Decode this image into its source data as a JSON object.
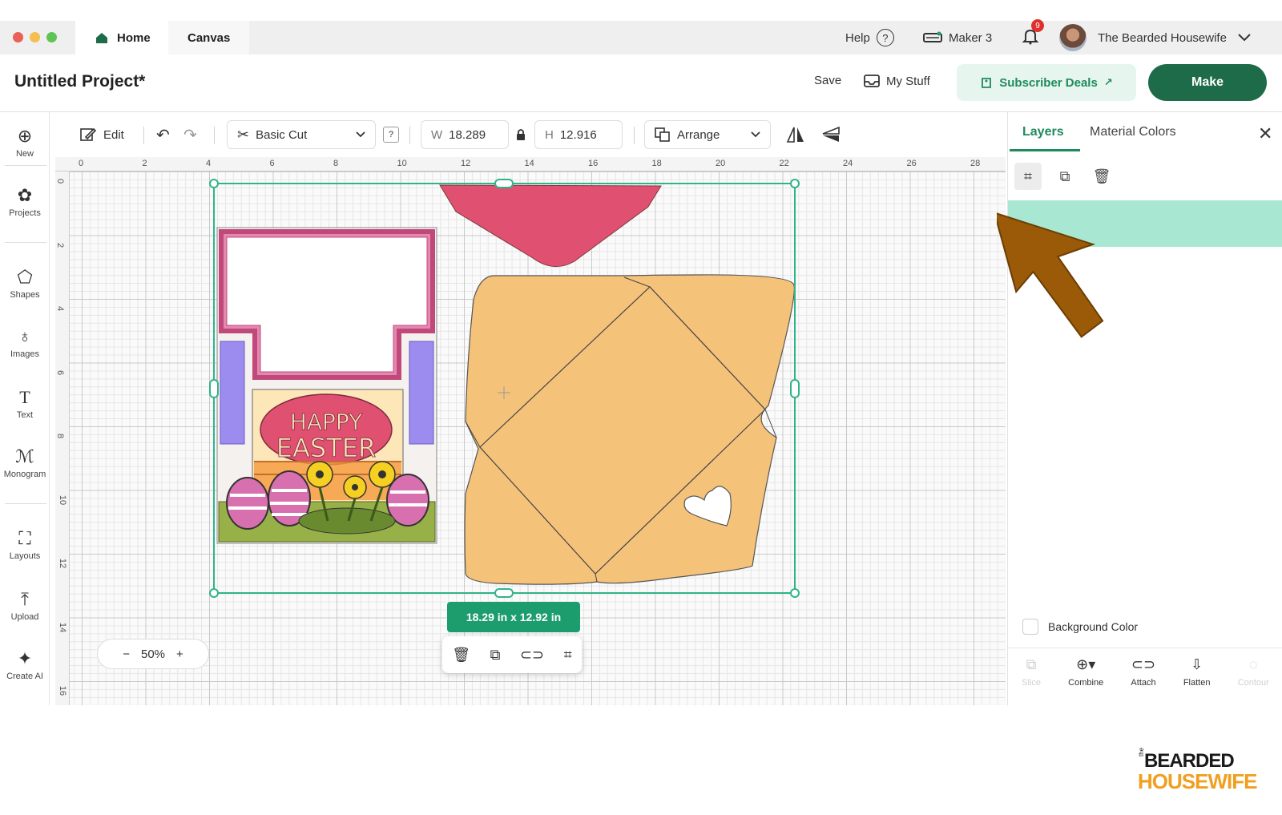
{
  "titlebar": {
    "tabs": [
      {
        "label": "Home",
        "icon": "home-icon"
      },
      {
        "label": "Canvas"
      }
    ],
    "help_label": "Help",
    "help_icon_glyph": "?",
    "machine_label": "Maker 3",
    "notification_count": "9",
    "account_name": "The Bearded Housewife"
  },
  "header": {
    "project_title": "Untitled Project*",
    "save_label": "Save",
    "mystuff_label": "My Stuff",
    "deals_label": "Subscriber Deals",
    "deals_arrow": "↗",
    "make_label": "Make"
  },
  "sidebar": {
    "items": [
      {
        "label": "New",
        "icon": "plus-circle-icon"
      },
      {
        "label": "Projects",
        "icon": "projects-icon"
      },
      {
        "label": "Shapes",
        "icon": "shapes-icon"
      },
      {
        "label": "Images",
        "icon": "images-icon"
      },
      {
        "label": "Text",
        "icon": "text-icon"
      },
      {
        "label": "Monogram",
        "icon": "monogram-icon"
      },
      {
        "label": "Layouts",
        "icon": "layouts-icon"
      },
      {
        "label": "Upload",
        "icon": "upload-icon"
      },
      {
        "label": "Create AI",
        "icon": "sparkle-icon"
      }
    ]
  },
  "toolbar": {
    "edit_label": "Edit",
    "operation_value": "Basic Cut",
    "help_glyph": "?",
    "width_label": "W",
    "width_value": "18.289",
    "height_label": "H",
    "height_value": "12.916",
    "arrange_label": "Arrange"
  },
  "canvas": {
    "ruler_top": [
      "0",
      "2",
      "4",
      "6",
      "8",
      "10",
      "12",
      "14",
      "16",
      "18",
      "20",
      "22",
      "24",
      "26",
      "28"
    ],
    "ruler_left": [
      "0",
      "2",
      "4",
      "6",
      "8",
      "10",
      "12",
      "14",
      "16"
    ],
    "zoom_value": "50%",
    "size_pill": "18.29  in x 12.92  in",
    "card_text": [
      "HAPPY",
      "EASTER"
    ],
    "colors": {
      "selection": "#2fb48a",
      "envelope": "#f5c27a",
      "flap": "#e05070",
      "card_frame": "#c0487a",
      "card_side": "#9c8cf0"
    }
  },
  "right_panel": {
    "tabs": [
      {
        "label": "Layers"
      },
      {
        "label": "Material Colors"
      }
    ],
    "background_color_label": "Background Color",
    "bottom_tools": [
      {
        "label": "Slice",
        "enabled": false,
        "icon": "slice-icon"
      },
      {
        "label": "Combine",
        "enabled": true,
        "icon": "combine-icon"
      },
      {
        "label": "Attach",
        "enabled": true,
        "icon": "attach-icon"
      },
      {
        "label": "Flatten",
        "enabled": true,
        "icon": "flatten-icon"
      },
      {
        "label": "Contour",
        "enabled": false,
        "icon": "contour-icon"
      }
    ],
    "annotation_color": "#9a5a08"
  },
  "watermark": {
    "line1": "BEARDED",
    "line2": "HOUSEWIFE",
    "prefix": "the"
  }
}
